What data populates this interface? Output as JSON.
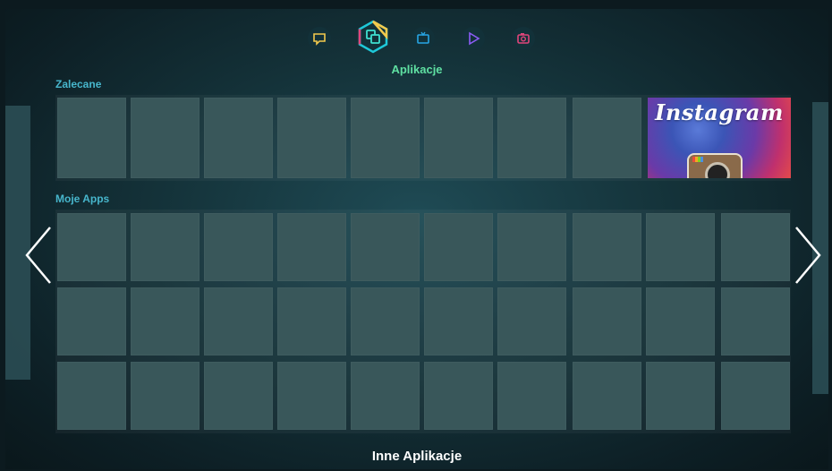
{
  "nav": {
    "items": [
      {
        "icon": "chat-icon",
        "color": "#f2c94c"
      },
      {
        "icon": "apps-icon",
        "color": "#1ec8d8"
      },
      {
        "icon": "tv-icon",
        "color": "#27a6e5"
      },
      {
        "icon": "play-icon",
        "color": "#8b5cf6"
      },
      {
        "icon": "camera-icon",
        "color": "#e0457b"
      }
    ],
    "active_label": "Aplikacje"
  },
  "sections": {
    "recommended": "Zalecane",
    "my_apps": "Moje Apps"
  },
  "featured_app": {
    "name": "Instagram"
  },
  "footer": {
    "label": "Inne Aplikacje"
  },
  "colors": {
    "accent_label": "#5fe0a2",
    "section_title": "#47b6cc",
    "tile": "#39575a"
  }
}
